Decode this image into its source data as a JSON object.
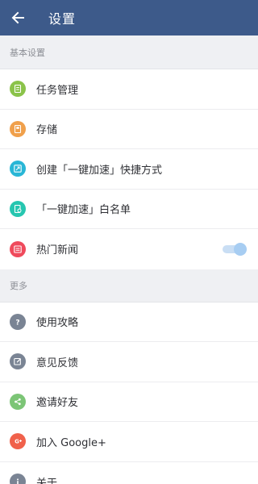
{
  "header": {
    "title": "设置"
  },
  "sections": [
    {
      "title": "基本设置",
      "items": [
        {
          "label": "任务管理",
          "icon": "task-list-icon",
          "color": "#8bc34a"
        },
        {
          "label": "存储",
          "icon": "storage-icon",
          "color": "#f0a04b"
        },
        {
          "label": "创建「一键加速」快捷方式",
          "icon": "shortcut-icon",
          "color": "#29b6d6"
        },
        {
          "label": "「一键加速」白名单",
          "icon": "whitelist-icon",
          "color": "#26c6b0"
        },
        {
          "label": "热门新闻",
          "icon": "news-icon",
          "color": "#ef4a5c",
          "toggle_on": true
        }
      ]
    },
    {
      "title": "更多",
      "items": [
        {
          "label": "使用攻略",
          "icon": "help-icon",
          "color": "#7a8494"
        },
        {
          "label": "意见反馈",
          "icon": "feedback-icon",
          "color": "#7a8494"
        },
        {
          "label": "邀请好友",
          "icon": "share-icon",
          "color": "#7cc576"
        },
        {
          "label": "加入 Google+",
          "icon": "google-plus-icon",
          "color": "#f0614b"
        },
        {
          "label": "关于",
          "icon": "info-icon",
          "color": "#7a8494"
        }
      ]
    }
  ]
}
